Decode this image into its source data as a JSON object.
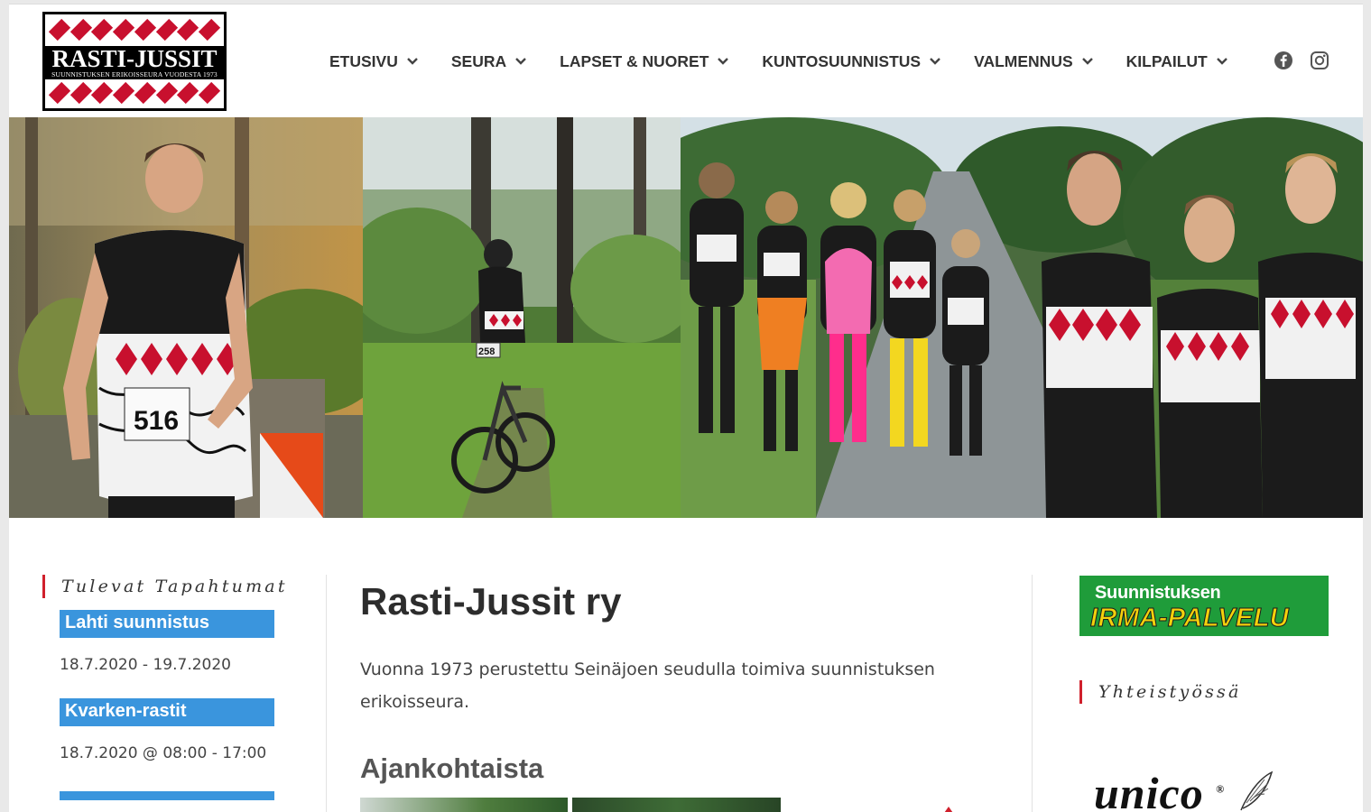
{
  "logo": {
    "name": "RASTI-JUSSIT",
    "tagline": "SUUNNISTUKSEN ERIKOISSEURA VUODESTA 1973"
  },
  "nav": [
    {
      "label": "ETUSIVU"
    },
    {
      "label": "SEURA"
    },
    {
      "label": "LAPSET & NUORET"
    },
    {
      "label": "KUNTOSUUNNISTUS"
    },
    {
      "label": "VALMENNUS"
    },
    {
      "label": "KILPAILUT"
    }
  ],
  "social": {
    "facebook": "facebook-icon",
    "instagram": "instagram-icon"
  },
  "banner": {
    "bib_1": "516",
    "bib_2": "258"
  },
  "sidebar_left": {
    "title": "Tulevat Tapahtumat",
    "events": [
      {
        "title": "Lahti suunnistus",
        "date": "18.7.2020 - 19.7.2020"
      },
      {
        "title": "Kvarken-rastit",
        "date": "18.7.2020 @ 08:00 - 17:00"
      }
    ]
  },
  "main": {
    "title": "Rasti-Jussit ry",
    "intro": "Vuonna 1973 perustettu Seinäjoen seudulla toimiva suunnistuksen erikoisseura.",
    "news_heading": "Ajankohtaista"
  },
  "sidebar_right": {
    "ad_line1": "Suunnistuksen",
    "ad_line2": "IRMA-PALVELU",
    "partners_title": "Yhteistyössä",
    "partner_logo": "unico"
  },
  "colors": {
    "accent_red": "#d0202c",
    "event_blue": "#3a95dd",
    "irma_green": "#1f9c3a",
    "irma_yellow": "#f4d10c"
  }
}
